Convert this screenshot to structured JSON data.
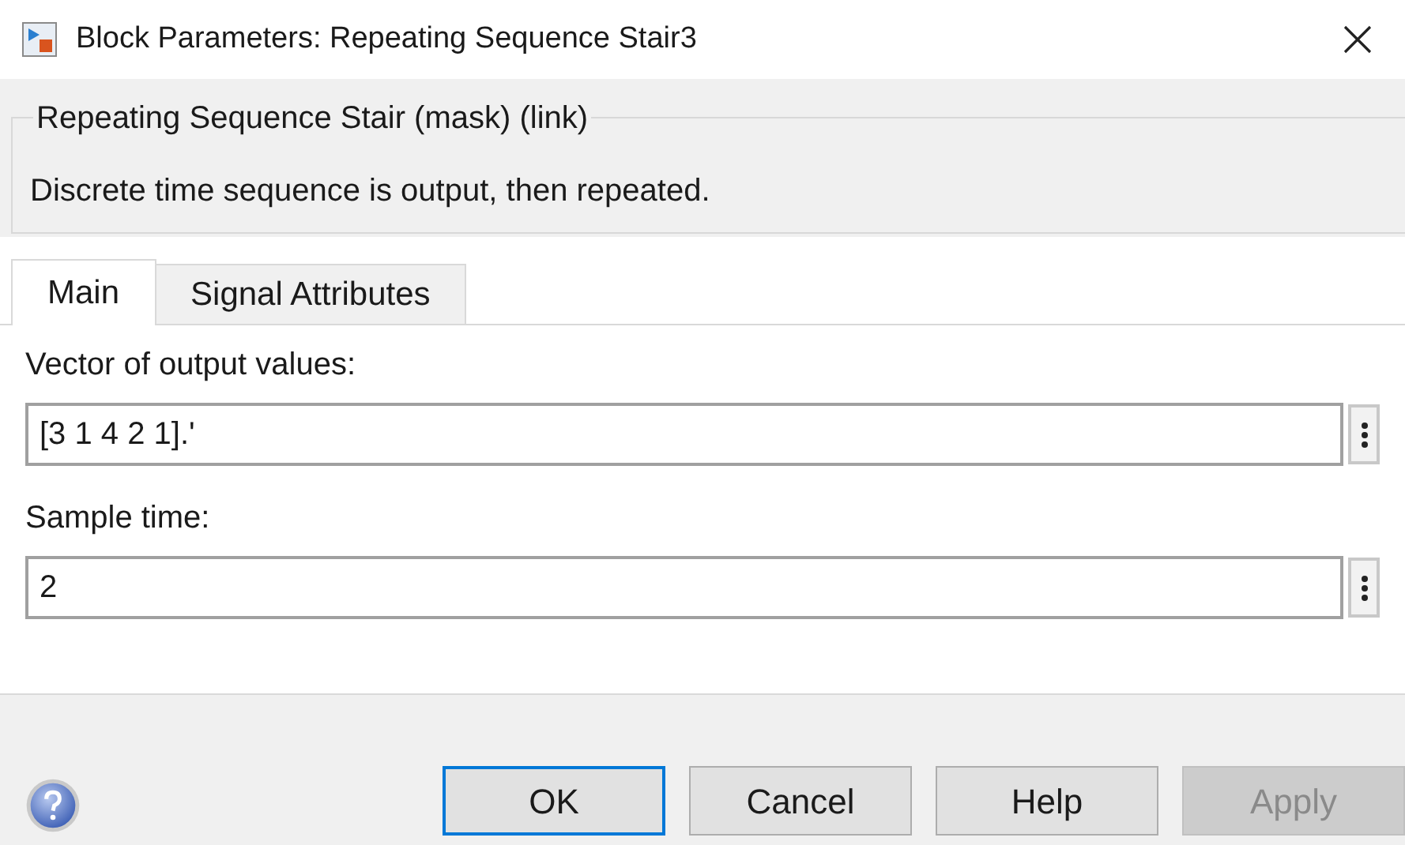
{
  "window": {
    "title": "Block Parameters: Repeating Sequence Stair3"
  },
  "group": {
    "title": "Repeating Sequence Stair (mask) (link)",
    "description": "Discrete time sequence is output, then repeated."
  },
  "tabs": [
    {
      "label": "Main",
      "selected": true
    },
    {
      "label": "Signal Attributes",
      "selected": false
    }
  ],
  "parameters": [
    {
      "label": "Vector of output values:",
      "value": "[3 1 4 2 1].'"
    },
    {
      "label": "Sample time:",
      "value": "2"
    }
  ],
  "buttons": [
    {
      "label": "OK",
      "default": true,
      "disabled": false
    },
    {
      "label": "Cancel",
      "default": false,
      "disabled": false
    },
    {
      "label": "Help",
      "default": false,
      "disabled": false
    },
    {
      "label": "Apply",
      "default": false,
      "disabled": true
    }
  ]
}
